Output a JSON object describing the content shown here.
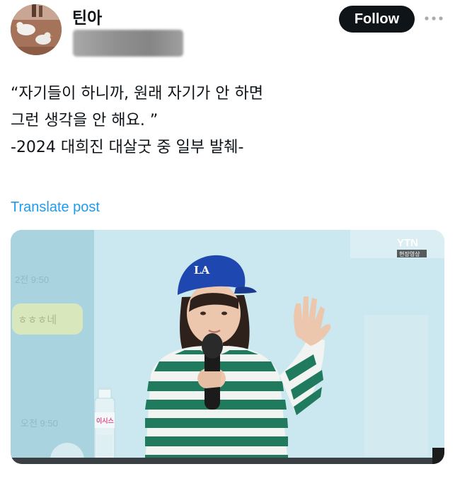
{
  "author": {
    "display_name": "틴아",
    "avatar_icon": "duck-photo-avatar",
    "handle_state": "redacted-blur"
  },
  "actions": {
    "follow_label": "Follow",
    "more_icon": "more-horizontal-icon"
  },
  "tweet": {
    "lines": [
      "“자기들이 하니까, 원래 자기가 안 하면",
      "그런 생각을 안 해요. ”",
      "-2024 대희진 대살굿 중 일부 발췌-"
    ]
  },
  "translate": {
    "label": "Translate post"
  },
  "media": {
    "broadcaster_logo": "YTN",
    "broadcaster_tag": "현장영상",
    "cap_logo": "LA",
    "bottle_label": "이시스",
    "chat_time_1": "2전 9:50",
    "chat_bubble_text": "ㅎㅎㅎ네",
    "chat_time_2": "오전 9:50",
    "colors": {
      "background": "#bfe0ea",
      "cap": "#1f47b0",
      "shirt_stripe": "#1f7a5e"
    }
  },
  "colors": {
    "link": "#1d9bf0",
    "text": "#0f1419",
    "button": "#0f1419"
  }
}
